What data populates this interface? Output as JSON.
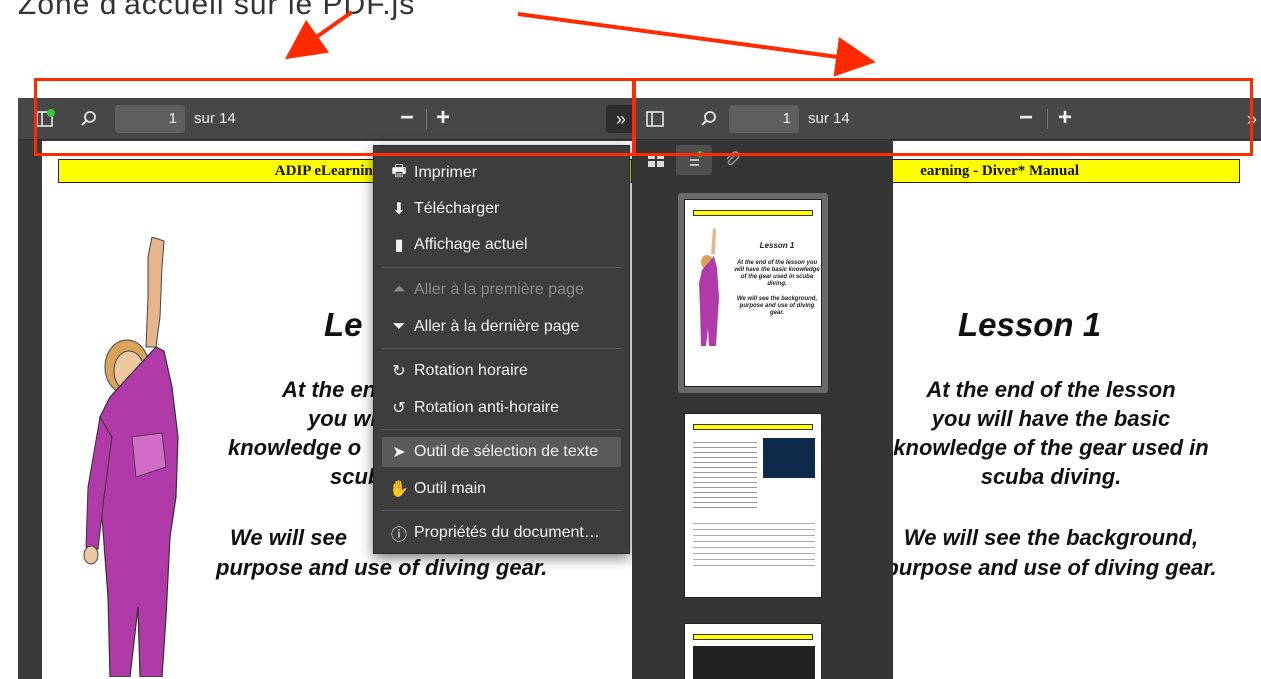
{
  "caption": "Zone d'accueil sur le PDF.js",
  "viewer": {
    "page_number": "1",
    "page_total": "sur 14",
    "zoom_out": "−",
    "zoom_in": "+",
    "more": "»"
  },
  "document": {
    "banner_left": "ADIP eLearning - Div",
    "banner_right": "earning - Diver* Manual",
    "left_title": "Le",
    "left_lines": [
      "At the en",
      "you will h",
      "knowledge o",
      "scub",
      "",
      "We will see",
      "purpose and use of diving gear."
    ],
    "right_title": "Lesson 1",
    "right_lines": [
      "At the end of the lesson",
      "you will have the basic",
      "knowledge of the gear used in",
      "scuba diving.",
      "",
      "We will see the background,",
      "purpose and use of diving gear."
    ]
  },
  "menu": {
    "items": [
      {
        "label": "Imprimer",
        "icon": "printer-icon",
        "glyph": "🖶"
      },
      {
        "label": "Télécharger",
        "icon": "download-icon",
        "glyph": "⬇"
      },
      {
        "label": "Affichage actuel",
        "icon": "bookmark-icon",
        "glyph": "▮"
      },
      {
        "label": "Aller à la première page",
        "icon": "first-page-icon",
        "glyph": "⏶"
      },
      {
        "label": "Aller à la dernière page",
        "icon": "last-page-icon",
        "glyph": "⏷"
      },
      {
        "label": "Rotation horaire",
        "icon": "rotate-cw-icon",
        "glyph": "↻"
      },
      {
        "label": "Rotation anti-horaire",
        "icon": "rotate-ccw-icon",
        "glyph": "↺"
      },
      {
        "label": "Outil de sélection de texte",
        "icon": "cursor-icon",
        "glyph": "➤"
      },
      {
        "label": "Outil main",
        "icon": "hand-icon",
        "glyph": "✋"
      },
      {
        "label": "Propriétés du document…",
        "icon": "info-icon",
        "glyph": "ⓘ"
      }
    ]
  },
  "thumbnail": {
    "banner": "ADIP eLearning - Diver* Manual",
    "title": "Lesson 1",
    "text": "At the end of the lesson you will have the basic knowledge of the gear used in scuba diving.",
    "text2": "We will see the background, purpose and use of diving gear."
  },
  "colors": {
    "highlight": "#ff2a00",
    "toolbar": "#474747",
    "banner": "#ffff00",
    "suit": "#b03aa8"
  }
}
